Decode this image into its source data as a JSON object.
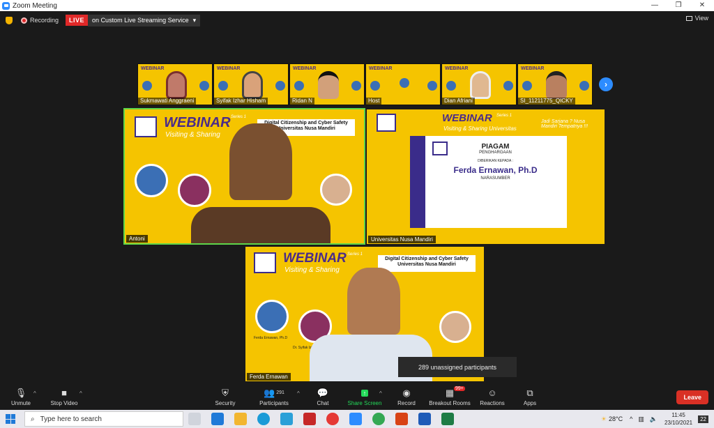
{
  "window": {
    "title": "Zoom Meeting",
    "controls": [
      "—",
      "❐",
      "✕"
    ]
  },
  "topbar": {
    "recording": "Recording",
    "live": "LIVE",
    "stream_service": "on Custom Live Streaming Service",
    "view": "View"
  },
  "thumbnails": [
    {
      "name": "Sukmawati Anggraeni",
      "badge": "WEBINAR"
    },
    {
      "name": "Syifak Izhar Hisham",
      "badge": "WEBINAR"
    },
    {
      "name": "Ridan N",
      "badge": "WEBINAR"
    },
    {
      "name": "Host",
      "badge": "WEBINAR"
    },
    {
      "name": "Dian Afriani",
      "badge": "WEBINAR"
    },
    {
      "name": "SI_11211775_QICKY",
      "badge": "WEBINAR"
    }
  ],
  "tiles": {
    "left": {
      "name": "Antoni",
      "webinar": "WEBINAR",
      "series": "Series 1",
      "visiting": "Visiting & Sharing",
      "topic": "Digital Citizenship and Cyber Safety",
      "uni": "Universitas Nusa Mandiri"
    },
    "right": {
      "name": "Universitas Nusa Mandiri",
      "webinar": "WEBINAR",
      "series": "Series 1",
      "visiting": "Visiting & Sharing Universitas",
      "piagam": "PIAGAM",
      "penghargaan": "PENGHARGAAN",
      "diberikan": "DIBERIKAN KEPADA :",
      "recipient": "Ferda Ernawan, Ph.D",
      "role": "NARASUMBER",
      "slogan": "Jadi Sarjana ? Nusa Mandiri Tempatnya !!!"
    },
    "bottom": {
      "name": "Ferda Ernawan",
      "webinar": "WEBINAR",
      "series": "Series 1",
      "visiting": "Visiting & Sharing",
      "topic": "Digital Citizenship and Cyber Safety",
      "uni": "Universitas Nusa Mandiri",
      "speaker1": "Ferda Ernawan, Ph.D",
      "speaker2": "Dr. Syifak Izhar Hisham"
    }
  },
  "popup": "289 unassigned participants",
  "toolbar": {
    "unmute": "Unmute",
    "stop_video": "Stop Video",
    "security": "Security",
    "participants": "Participants",
    "participant_count": "291",
    "chat": "Chat",
    "share_screen": "Share Screen",
    "record": "Record",
    "breakout": "Breakout Rooms",
    "breakout_badge": "99+",
    "reactions": "Reactions",
    "apps": "Apps",
    "leave": "Leave"
  },
  "taskbar": {
    "search_placeholder": "Type here to search",
    "weather": "28°C",
    "time": "11:45",
    "date": "23/10/2021",
    "notif": "22"
  },
  "colors": {
    "zoom_blue": "#2d8cff",
    "live_red": "#e02828",
    "webinar_yellow": "#f5c400",
    "share_green": "#23d959",
    "active_border": "#5ed64a"
  }
}
